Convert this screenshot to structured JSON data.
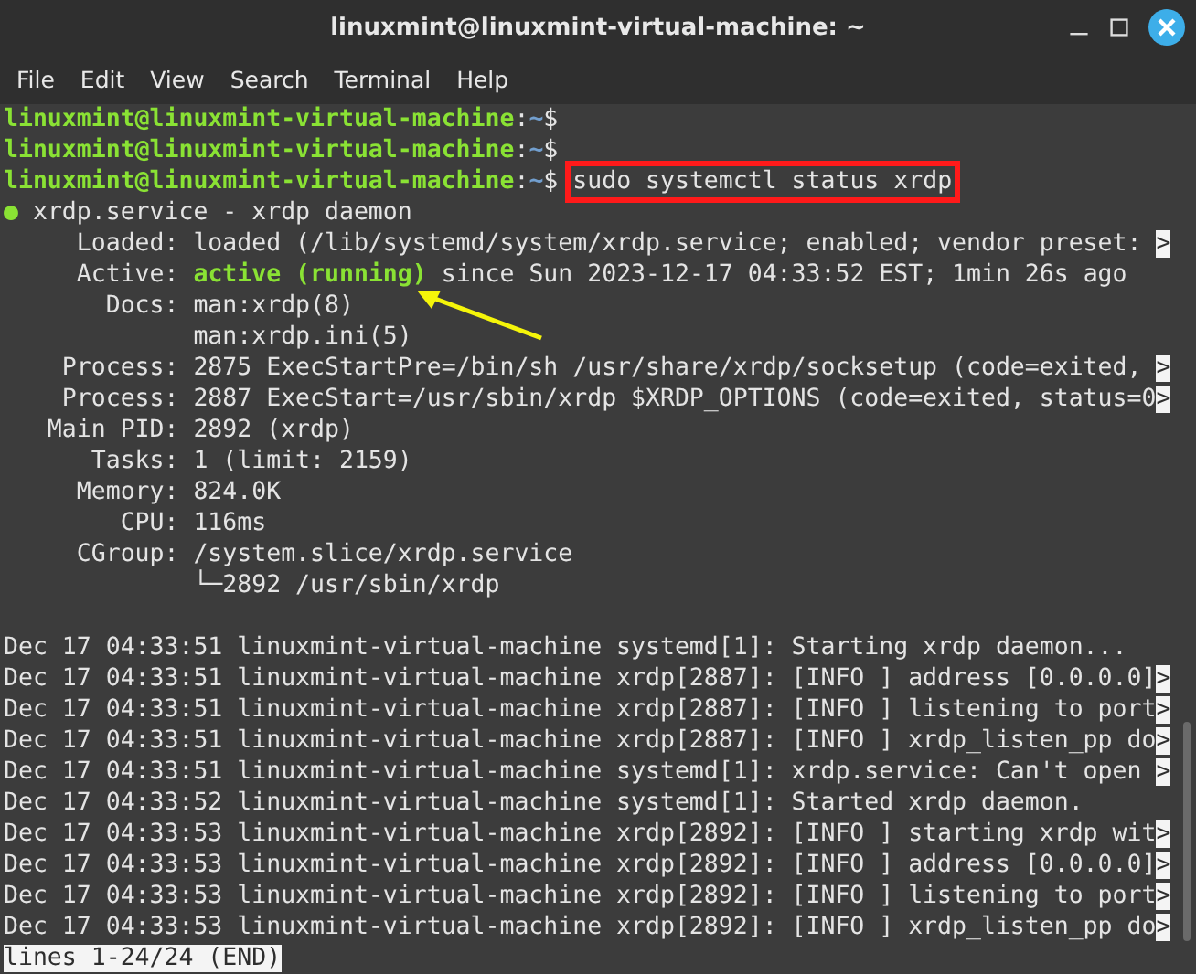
{
  "window": {
    "title": "linuxmint@linuxmint-virtual-machine: ~"
  },
  "menu": [
    "File",
    "Edit",
    "View",
    "Search",
    "Terminal",
    "Help"
  ],
  "terminal": {
    "lines": [
      {
        "segments": [
          {
            "kind": "user",
            "text": "linuxmint@linuxmint-virtual-machine"
          },
          {
            "kind": "plain",
            "text": ":"
          },
          {
            "kind": "path",
            "text": "~"
          },
          {
            "kind": "plain",
            "text": "$"
          }
        ]
      },
      {
        "segments": [
          {
            "kind": "user",
            "text": "linuxmint@linuxmint-virtual-machine"
          },
          {
            "kind": "plain",
            "text": ":"
          },
          {
            "kind": "path",
            "text": "~"
          },
          {
            "kind": "plain",
            "text": "$"
          }
        ]
      },
      {
        "segments": [
          {
            "kind": "user",
            "text": "linuxmint@linuxmint-virtual-machine"
          },
          {
            "kind": "plain",
            "text": ":"
          },
          {
            "kind": "path",
            "text": "~"
          },
          {
            "kind": "plain",
            "text": "$ "
          },
          {
            "kind": "highlighted",
            "text": "sudo systemctl status xrdp"
          }
        ]
      },
      {
        "segments": [
          {
            "kind": "dot",
            "text": "●"
          },
          {
            "kind": "plain",
            "text": " xrdp.service - xrdp daemon"
          }
        ]
      },
      {
        "segments": [
          {
            "kind": "plain",
            "text": "     Loaded: loaded (/lib/systemd/system/xrdp.service; enabled; vendor preset: "
          },
          {
            "kind": "overflow",
            "text": ">"
          }
        ]
      },
      {
        "segments": [
          {
            "kind": "plain",
            "text": "     Active: "
          },
          {
            "kind": "status",
            "text": "active (running)"
          },
          {
            "kind": "plain",
            "text": " since Sun 2023-12-17 04:33:52 EST; 1min 26s ago"
          }
        ]
      },
      {
        "segments": [
          {
            "kind": "plain",
            "text": "       Docs: man:xrdp(8)"
          }
        ]
      },
      {
        "segments": [
          {
            "kind": "plain",
            "text": "             man:xrdp.ini(5)"
          }
        ]
      },
      {
        "segments": [
          {
            "kind": "plain",
            "text": "    Process: 2875 ExecStartPre=/bin/sh /usr/share/xrdp/socksetup (code=exited, "
          },
          {
            "kind": "overflow",
            "text": ">"
          }
        ]
      },
      {
        "segments": [
          {
            "kind": "plain",
            "text": "    Process: 2887 ExecStart=/usr/sbin/xrdp $XRDP_OPTIONS (code=exited, status=0"
          },
          {
            "kind": "overflow",
            "text": ">"
          }
        ]
      },
      {
        "segments": [
          {
            "kind": "plain",
            "text": "   Main PID: 2892 (xrdp)"
          }
        ]
      },
      {
        "segments": [
          {
            "kind": "plain",
            "text": "      Tasks: 1 (limit: 2159)"
          }
        ]
      },
      {
        "segments": [
          {
            "kind": "plain",
            "text": "     Memory: 824.0K"
          }
        ]
      },
      {
        "segments": [
          {
            "kind": "plain",
            "text": "        CPU: 116ms"
          }
        ]
      },
      {
        "segments": [
          {
            "kind": "plain",
            "text": "     CGroup: /system.slice/xrdp.service"
          }
        ]
      },
      {
        "segments": [
          {
            "kind": "plain",
            "text": "             └─2892 /usr/sbin/xrdp"
          }
        ]
      },
      {
        "blank_before": true,
        "segments": [
          {
            "kind": "plain",
            "text": "Dec 17 04:33:51 linuxmint-virtual-machine systemd[1]: Starting xrdp daemon..."
          }
        ]
      },
      {
        "segments": [
          {
            "kind": "plain",
            "text": "Dec 17 04:33:51 linuxmint-virtual-machine xrdp[2887]: [INFO ] address [0.0.0.0]"
          },
          {
            "kind": "overflow",
            "text": ">"
          }
        ]
      },
      {
        "segments": [
          {
            "kind": "plain",
            "text": "Dec 17 04:33:51 linuxmint-virtual-machine xrdp[2887]: [INFO ] listening to port"
          },
          {
            "kind": "overflow",
            "text": ">"
          }
        ]
      },
      {
        "segments": [
          {
            "kind": "plain",
            "text": "Dec 17 04:33:51 linuxmint-virtual-machine xrdp[2887]: [INFO ] xrdp_listen_pp do"
          },
          {
            "kind": "overflow",
            "text": ">"
          }
        ]
      },
      {
        "segments": [
          {
            "kind": "plain",
            "text": "Dec 17 04:33:51 linuxmint-virtual-machine systemd[1]: xrdp.service: Can't open "
          },
          {
            "kind": "overflow",
            "text": ">"
          }
        ]
      },
      {
        "segments": [
          {
            "kind": "plain",
            "text": "Dec 17 04:33:52 linuxmint-virtual-machine systemd[1]: Started xrdp daemon."
          }
        ]
      },
      {
        "segments": [
          {
            "kind": "plain",
            "text": "Dec 17 04:33:53 linuxmint-virtual-machine xrdp[2892]: [INFO ] starting xrdp wit"
          },
          {
            "kind": "overflow",
            "text": ">"
          }
        ]
      },
      {
        "segments": [
          {
            "kind": "plain",
            "text": "Dec 17 04:33:53 linuxmint-virtual-machine xrdp[2892]: [INFO ] address [0.0.0.0]"
          },
          {
            "kind": "overflow",
            "text": ">"
          }
        ]
      },
      {
        "segments": [
          {
            "kind": "plain",
            "text": "Dec 17 04:33:53 linuxmint-virtual-machine xrdp[2892]: [INFO ] listening to port"
          },
          {
            "kind": "overflow",
            "text": ">"
          }
        ]
      },
      {
        "segments": [
          {
            "kind": "plain",
            "text": "Dec 17 04:33:53 linuxmint-virtual-machine xrdp[2892]: [INFO ] xrdp_listen_pp do"
          },
          {
            "kind": "overflow",
            "text": ">"
          }
        ]
      },
      {
        "segments": [
          {
            "kind": "pager",
            "text": "lines 1-24/24 (END)"
          }
        ]
      }
    ]
  }
}
